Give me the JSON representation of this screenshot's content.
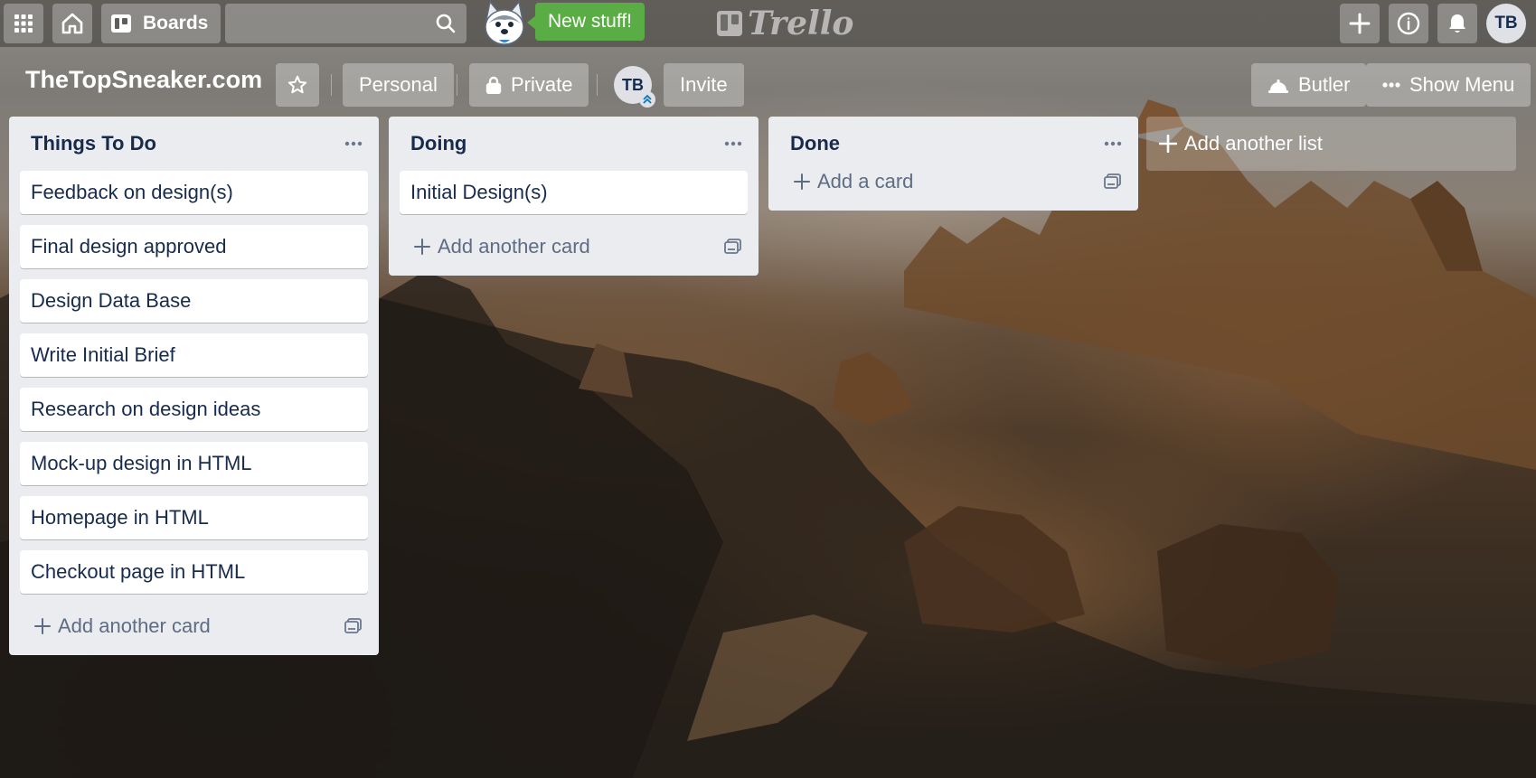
{
  "header": {
    "apps_icon": "grid-icon",
    "home_icon": "home-icon",
    "boards_label": "Boards",
    "search_value": "",
    "search_placeholder": "",
    "new_stuff_label": "New stuff!",
    "logo_text": "Trello",
    "avatar_initials": "TB"
  },
  "board": {
    "title": "TheTopSneaker.com",
    "visibility_team": "Personal",
    "visibility_privacy": "Private",
    "member_initials": "TB",
    "invite_label": "Invite",
    "butler_label": "Butler",
    "show_menu_label": "Show Menu"
  },
  "lists": [
    {
      "title": "Things To Do",
      "cards": [
        "Feedback on design(s)",
        "Final design approved",
        "Design Data Base",
        "Write Initial Brief",
        "Research on design ideas",
        "Mock-up design in HTML",
        "Homepage in HTML",
        "Checkout page in HTML"
      ],
      "add_label": "Add another card"
    },
    {
      "title": "Doing",
      "cards": [
        "Initial Design(s)"
      ],
      "add_label": "Add another card"
    },
    {
      "title": "Done",
      "cards": [],
      "add_label": "Add a card"
    }
  ],
  "add_list_label": "Add another list",
  "colors": {
    "new_stuff_green": "#5aac44",
    "list_bg": "#ebecf0",
    "card_text": "#172b4d"
  }
}
